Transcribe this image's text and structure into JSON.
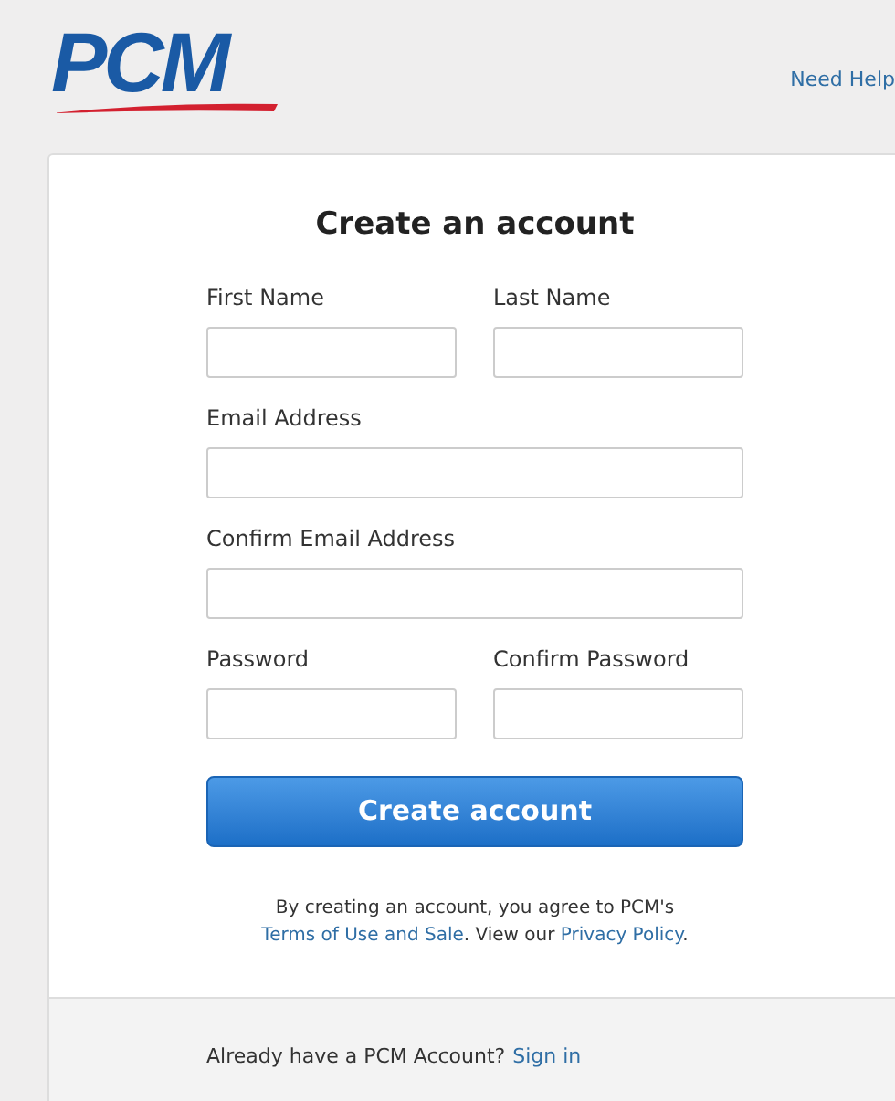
{
  "header": {
    "logo": "PCM",
    "help_link": "Need Help"
  },
  "form": {
    "title": "Create an account",
    "rows": [
      [
        {
          "label": "First Name"
        },
        {
          "label": "Last Name"
        }
      ],
      [
        {
          "label": "Email Address"
        }
      ],
      [
        {
          "label": "Confirm Email Address"
        }
      ],
      [
        {
          "label": "Password"
        },
        {
          "label": "Confirm Password"
        }
      ]
    ],
    "submit": "Create account",
    "agreement": {
      "text": "By creating an account, you agree to PCM's",
      "terms_link": "Terms of Use and Sale",
      "middle": ". View our",
      "privacy_link": "Privacy Policy",
      "end": "."
    }
  },
  "footer": {
    "text": "Already have a PCM Account?",
    "sign_in_link": "Sign in"
  }
}
